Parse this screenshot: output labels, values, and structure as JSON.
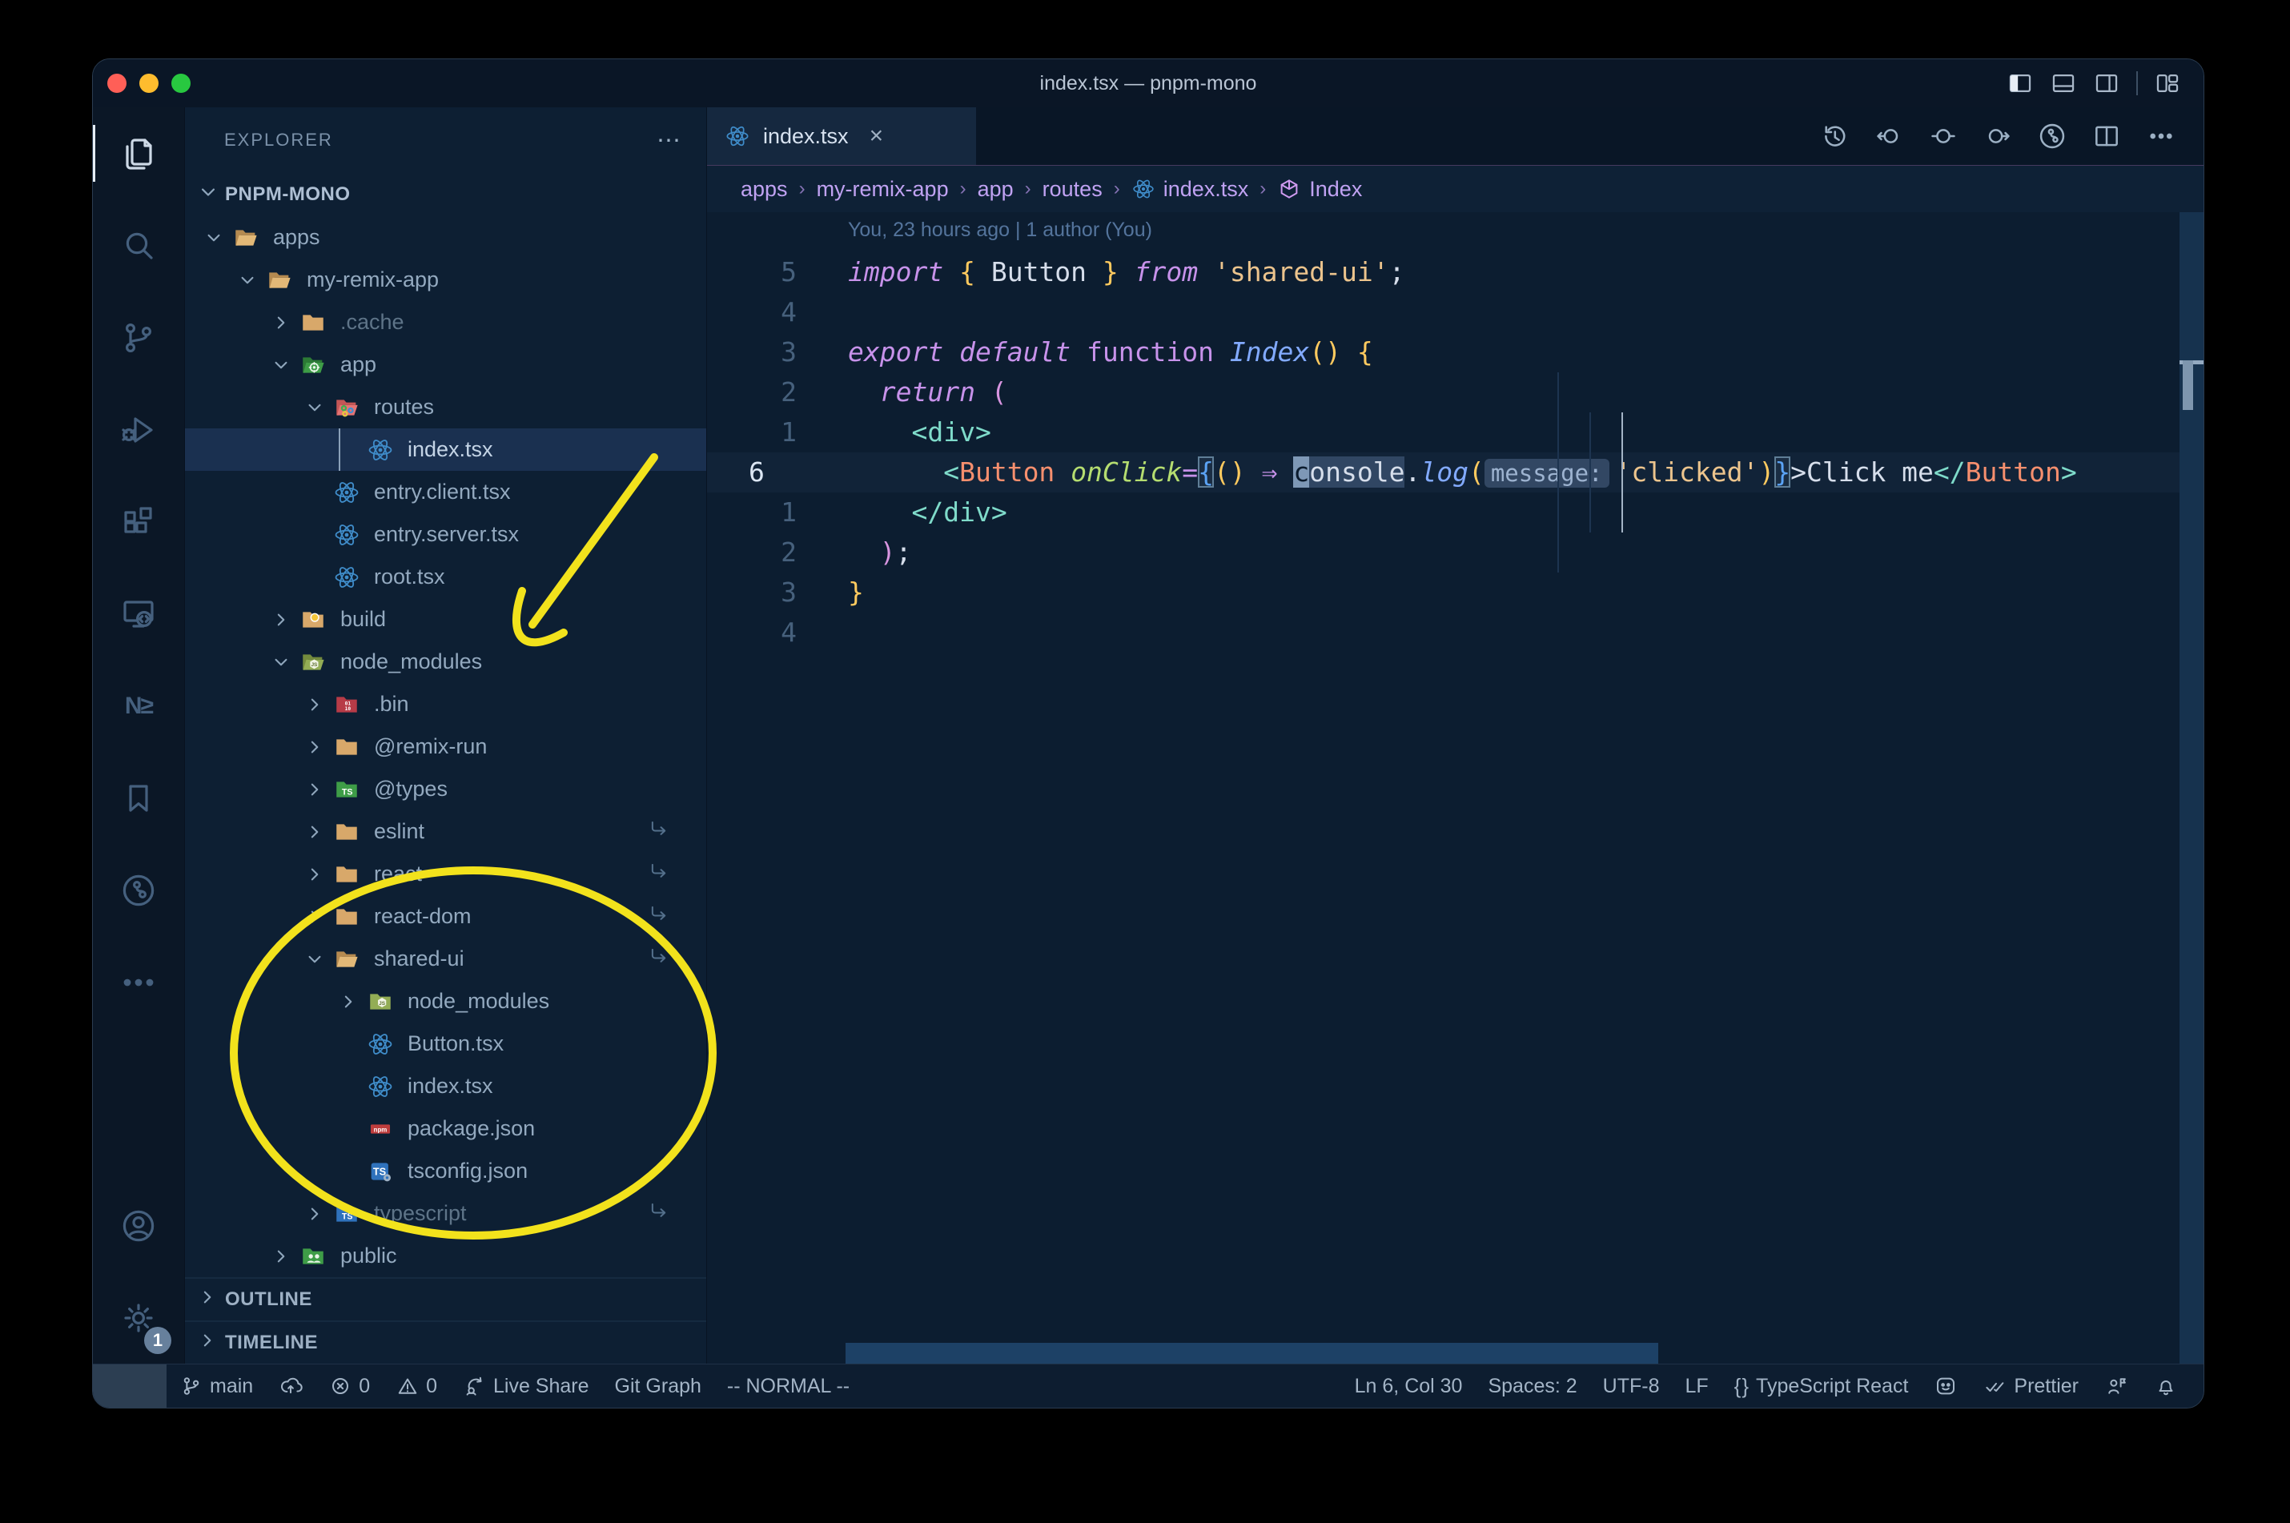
{
  "window": {
    "title": "index.tsx — pnpm-mono"
  },
  "titlebar_icons": [
    "panel-left",
    "panel-bottom",
    "panel-right",
    "divider",
    "layout"
  ],
  "activity_bar": {
    "top": [
      {
        "icon": "explorer",
        "active": true
      },
      {
        "icon": "search"
      },
      {
        "icon": "source-control"
      },
      {
        "icon": "run-debug"
      },
      {
        "icon": "extensions"
      },
      {
        "icon": "remote-explorer"
      },
      {
        "icon": "nx-console",
        "text": "N≥"
      },
      {
        "icon": "bookmarks"
      },
      {
        "icon": "gitlens"
      },
      {
        "icon": "more"
      }
    ],
    "bottom": [
      {
        "icon": "account"
      },
      {
        "icon": "settings",
        "badge": "1"
      }
    ]
  },
  "explorer": {
    "header": "EXPLORER",
    "header_more": "⋯",
    "root": "PNPM-MONO",
    "items": [
      {
        "label": "apps",
        "kind": "folder",
        "icon": "folder-open",
        "level": 0,
        "expanded": true
      },
      {
        "label": "my-remix-app",
        "kind": "folder",
        "icon": "folder-open",
        "level": 1,
        "expanded": true
      },
      {
        "label": ".cache",
        "kind": "folder",
        "icon": "folder",
        "level": 2,
        "dimmed": true
      },
      {
        "label": "app",
        "kind": "folder",
        "icon": "folder-app-open",
        "level": 2,
        "expanded": true
      },
      {
        "label": "routes",
        "kind": "folder",
        "icon": "folder-routes-open",
        "level": 3,
        "expanded": true
      },
      {
        "label": "index.tsx",
        "kind": "file",
        "icon": "react",
        "level": 4,
        "selected": true
      },
      {
        "label": "entry.client.tsx",
        "kind": "file",
        "icon": "react",
        "level": 3
      },
      {
        "label": "entry.server.tsx",
        "kind": "file",
        "icon": "react",
        "level": 3
      },
      {
        "label": "root.tsx",
        "kind": "file",
        "icon": "react",
        "level": 3
      },
      {
        "label": "build",
        "kind": "folder",
        "icon": "folder-build",
        "level": 2
      },
      {
        "label": "node_modules",
        "kind": "folder",
        "icon": "folder-node-open",
        "level": 2,
        "expanded": true
      },
      {
        "label": ".bin",
        "kind": "folder",
        "icon": "folder-bin",
        "level": 3
      },
      {
        "label": "@remix-run",
        "kind": "folder",
        "icon": "folder",
        "level": 3
      },
      {
        "label": "@types",
        "kind": "folder",
        "icon": "folder-types",
        "level": 3
      },
      {
        "label": "eslint",
        "kind": "folder",
        "icon": "folder",
        "level": 3,
        "symlink": true
      },
      {
        "label": "react",
        "kind": "folder",
        "icon": "folder",
        "level": 3,
        "symlink": true
      },
      {
        "label": "react-dom",
        "kind": "folder",
        "icon": "folder",
        "level": 3,
        "symlink": true
      },
      {
        "label": "shared-ui",
        "kind": "folder",
        "icon": "folder-open",
        "level": 3,
        "expanded": true,
        "symlink": true
      },
      {
        "label": "node_modules",
        "kind": "folder",
        "icon": "folder-node",
        "level": 4
      },
      {
        "label": "Button.tsx",
        "kind": "file",
        "icon": "react",
        "level": 4
      },
      {
        "label": "index.tsx",
        "kind": "file",
        "icon": "react",
        "level": 4
      },
      {
        "label": "package.json",
        "kind": "file",
        "icon": "npm",
        "level": 4
      },
      {
        "label": "tsconfig.json",
        "kind": "file",
        "icon": "tsconfig",
        "level": 4
      },
      {
        "label": "typescript",
        "kind": "folder",
        "icon": "folder-ts",
        "level": 3,
        "dimmed": true,
        "symlink": true
      },
      {
        "label": "public",
        "kind": "folder",
        "icon": "folder-public",
        "level": 2
      }
    ],
    "sections": [
      {
        "label": "OUTLINE"
      },
      {
        "label": "TIMELINE"
      }
    ]
  },
  "tab": {
    "label": "index.tsx",
    "close": "×",
    "icon": "react"
  },
  "editor_actions": [
    "history",
    "nav-back",
    "nav-circle",
    "nav-forward",
    "gitlens-circle",
    "split-editor",
    "more-dots"
  ],
  "breadcrumbs": [
    {
      "label": "apps"
    },
    {
      "label": "my-remix-app"
    },
    {
      "label": "app"
    },
    {
      "label": "routes"
    },
    {
      "label": "index.tsx",
      "icon": "react"
    },
    {
      "label": "Index",
      "icon": "symbol-cube"
    }
  ],
  "code": {
    "blame": "You, 23 hours ago | 1 author (You)",
    "lines": [
      {
        "num": "5",
        "tokens": [
          [
            "import",
            "kwi"
          ],
          [
            " ",
            "d"
          ],
          [
            "{",
            "gold"
          ],
          [
            " Button ",
            "d"
          ],
          [
            "}",
            "gold"
          ],
          [
            " ",
            "d"
          ],
          [
            "from",
            "kwi"
          ],
          [
            " ",
            "d"
          ],
          [
            "'shared-ui'",
            "str"
          ],
          [
            ";",
            "d"
          ]
        ]
      },
      {
        "num": "4",
        "tokens": []
      },
      {
        "num": "3",
        "tokens": [
          [
            "export",
            "kwi"
          ],
          [
            " ",
            "d"
          ],
          [
            "default",
            "kwi"
          ],
          [
            " ",
            "d"
          ],
          [
            "function",
            "kw"
          ],
          [
            " ",
            "d"
          ],
          [
            "Index",
            "fni"
          ],
          [
            "()",
            "gold"
          ],
          [
            " ",
            "d"
          ],
          [
            "{",
            "gold"
          ]
        ]
      },
      {
        "num": "2",
        "tokens": [
          [
            "  ",
            "d"
          ],
          [
            "return",
            "kwi"
          ],
          [
            " ",
            "d"
          ],
          [
            "(",
            "pk"
          ]
        ]
      },
      {
        "num": "1",
        "tokens": [
          [
            "    ",
            "d"
          ],
          [
            "<div>",
            "teal"
          ]
        ]
      },
      {
        "num": "6",
        "current": true,
        "tokens": [
          [
            "      ",
            "d"
          ],
          [
            "<",
            "teal"
          ],
          [
            "Button",
            "tag"
          ],
          [
            " ",
            "d"
          ],
          [
            "onClick",
            "attr"
          ],
          [
            "=",
            "kw"
          ],
          [
            "{",
            "jb"
          ],
          [
            "()",
            "gold"
          ],
          [
            " ",
            "d"
          ],
          [
            "⇒",
            "kw"
          ],
          [
            " ",
            "d"
          ],
          [
            "c",
            "cur"
          ],
          [
            "onsole",
            "hl"
          ],
          [
            ".",
            "d"
          ],
          [
            "log",
            "fni"
          ],
          [
            "(",
            "gold"
          ],
          [
            "message:",
            "inlay"
          ],
          [
            "'clicked'",
            "str"
          ],
          [
            ")",
            "gold"
          ],
          [
            "}",
            "jb"
          ],
          [
            ">",
            "d"
          ],
          [
            "Click me",
            "d"
          ],
          [
            "</",
            "teal"
          ],
          [
            "Button",
            "tag"
          ],
          [
            ">",
            "teal"
          ]
        ]
      },
      {
        "num": "1",
        "tokens": [
          [
            "    ",
            "d"
          ],
          [
            "</div>",
            "teal"
          ]
        ]
      },
      {
        "num": "2",
        "tokens": [
          [
            "  ",
            "d"
          ],
          [
            ")",
            "pk"
          ],
          [
            ";",
            "d"
          ]
        ]
      },
      {
        "num": "3",
        "tokens": [
          [
            "}",
            "gold"
          ]
        ]
      },
      {
        "num": "4",
        "tokens": []
      }
    ]
  },
  "statusbar": {
    "left": [
      {
        "icon": "remote",
        "name": "remote-indicator"
      },
      {
        "icon": "branch",
        "label": "main",
        "name": "git-branch"
      },
      {
        "icon": "sync",
        "name": "sync"
      },
      {
        "icon": "error",
        "label": "0",
        "name": "errors"
      },
      {
        "icon": "warning",
        "label": "0",
        "name": "warnings"
      },
      {
        "icon": "liveshare",
        "label": "Live Share",
        "name": "live-share"
      },
      {
        "label": "Git Graph",
        "name": "git-graph"
      },
      {
        "label": "-- NORMAL --",
        "name": "vim-mode"
      }
    ],
    "right": [
      {
        "label": "Ln 6, Col 30",
        "name": "cursor-position"
      },
      {
        "label": "Spaces: 2",
        "name": "indentation"
      },
      {
        "label": "UTF-8",
        "name": "encoding"
      },
      {
        "label": "LF",
        "name": "eol"
      },
      {
        "icon": "braces",
        "label": "TypeScript React",
        "name": "language-mode"
      },
      {
        "icon": "smiley",
        "name": "feedback"
      },
      {
        "icon": "double-check",
        "label": "Prettier",
        "name": "formatter"
      },
      {
        "icon": "person-flag",
        "name": "accessibility"
      },
      {
        "icon": "bell",
        "name": "notifications"
      }
    ]
  },
  "annotation_color": "#f2e21c"
}
